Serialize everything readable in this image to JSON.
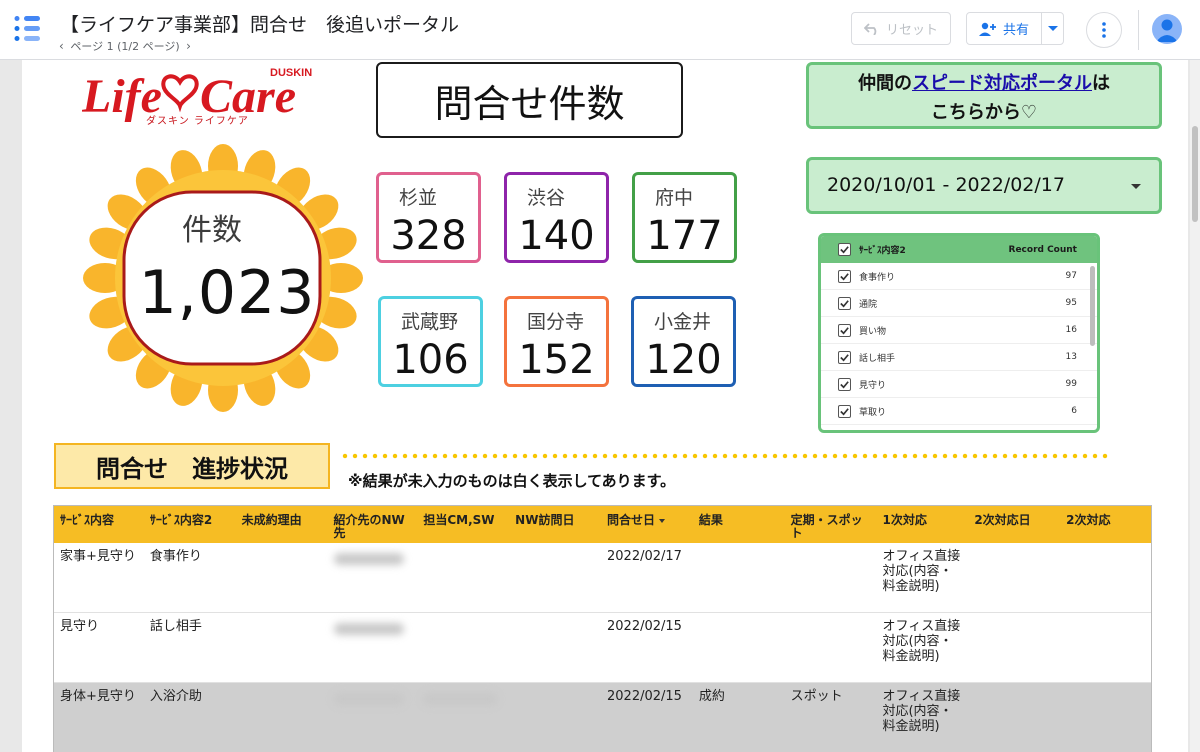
{
  "header": {
    "title": "【ライフケア事業部】問合せ　後追いポータル",
    "page_info": "ページ 1 (1/2 ページ)",
    "reset_label": "リセット",
    "share_label": "共有"
  },
  "logo": {
    "text": "LifeCare",
    "brand": "DUSKIN",
    "subtitle": "ダスキン ライフケア"
  },
  "total": {
    "label": "件数",
    "value": "1,023"
  },
  "main_title": "問合せ件数",
  "areas": [
    {
      "name": "杉並",
      "value": "328",
      "color": "#e0608e"
    },
    {
      "name": "渋谷",
      "value": "140",
      "color": "#8e24aa"
    },
    {
      "name": "府中",
      "value": "177",
      "color": "#43a047"
    },
    {
      "name": "武蔵野",
      "value": "106",
      "color": "#4dd0e1"
    },
    {
      "name": "国分寺",
      "value": "152",
      "color": "#f4733d"
    },
    {
      "name": "小金井",
      "value": "120",
      "color": "#1e5fb3"
    }
  ],
  "speed_link": {
    "prefix": "仲間の",
    "link": "スピード対応ポータル",
    "suffix": "は",
    "line2": "こちらから♡"
  },
  "date_range": "2020/10/01 - 2022/02/17",
  "service_filter": {
    "header_label": "ｻｰﾋﾞｽ内容2",
    "header_count": "Record Count",
    "items": [
      {
        "label": "食事作り",
        "count": "97"
      },
      {
        "label": "通院",
        "count": "95"
      },
      {
        "label": "買い物",
        "count": "16"
      },
      {
        "label": "話し相手",
        "count": "13"
      },
      {
        "label": "見守り",
        "count": "99"
      },
      {
        "label": "草取り",
        "count": "6"
      }
    ]
  },
  "section": {
    "title": "問合せ　進捗状況",
    "note": "※結果が未入力のものは白く表示してあります。"
  },
  "table": {
    "columns": [
      "ｻｰﾋﾞｽ内容",
      "ｻｰﾋﾞｽ内容2",
      "未成約理由",
      "紹介先のNW先",
      "担当CM,SW",
      "NW訪問日",
      "問合せ日",
      "結果",
      "定期・スポット",
      "1次対応",
      "2次対応日",
      "2次対応"
    ],
    "rows": [
      [
        "家事+見守り",
        "食事作り",
        "",
        "",
        "",
        "",
        "2022/02/17",
        "",
        "",
        "オフィス直接対応(内容・料金説明)",
        "",
        ""
      ],
      [
        "見守り",
        "話し相手",
        "",
        "",
        "",
        "",
        "2022/02/15",
        "",
        "",
        "オフィス直接対応(内容・料金説明)",
        "",
        ""
      ],
      [
        "身体+見守り",
        "入浴介助",
        "",
        "",
        "",
        "",
        "2022/02/15",
        "成約",
        "スポット",
        "オフィス直接対応(内容・料金説明)",
        "",
        ""
      ]
    ]
  },
  "colors": {
    "accent_green": "#69c37a",
    "header_yellow": "#f6bd24",
    "sun_orange": "#f9b52c"
  }
}
